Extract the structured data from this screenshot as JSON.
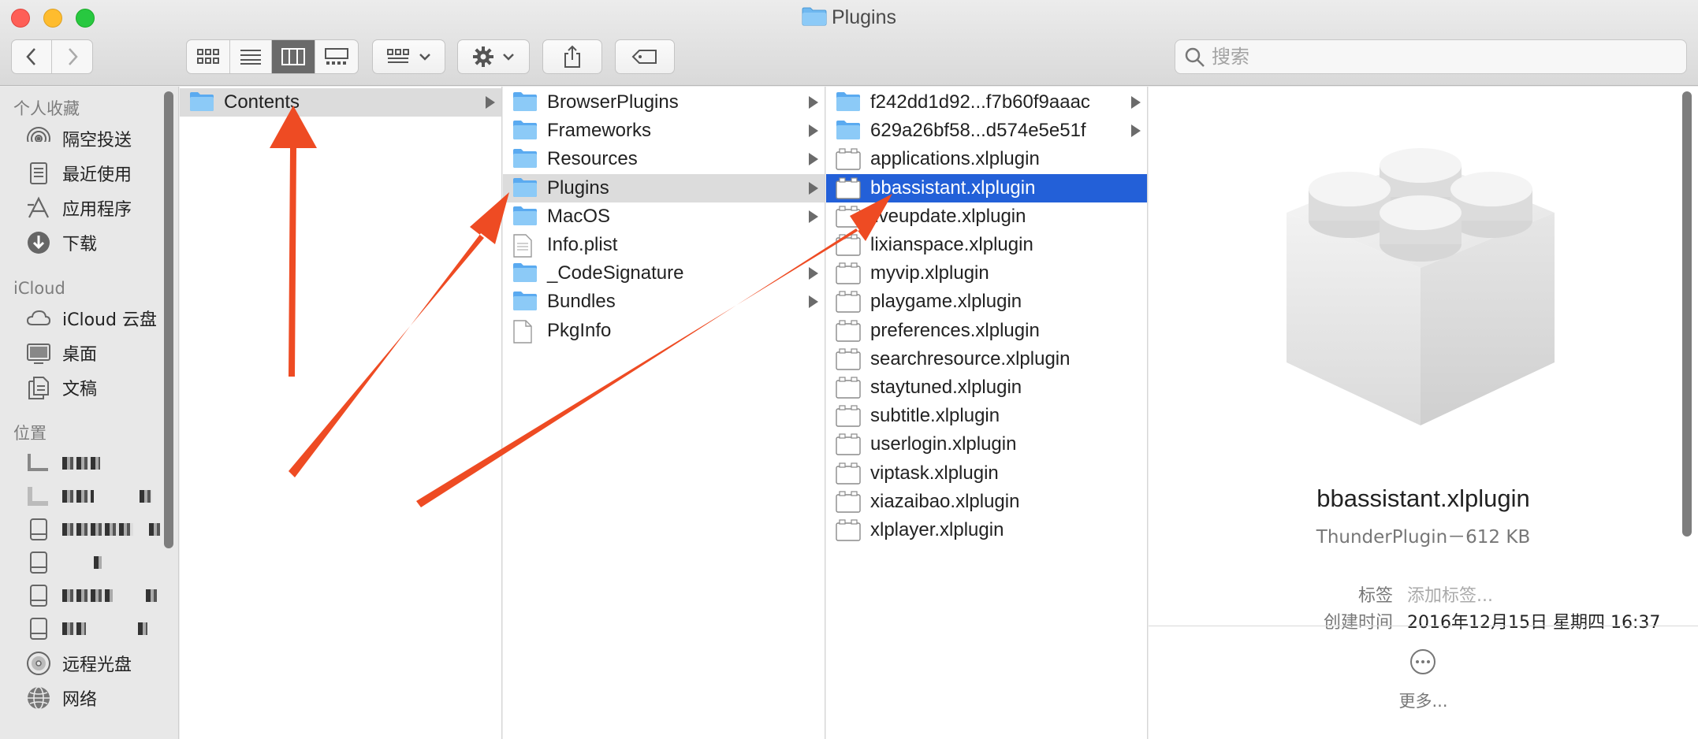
{
  "window": {
    "title": "Plugins"
  },
  "toolbar": {
    "back_label": "",
    "forward_label": "",
    "view_modes": [
      "icon-view",
      "list-view",
      "column-view",
      "gallery-view"
    ],
    "active_view": "column-view"
  },
  "search": {
    "placeholder": "搜索"
  },
  "sidebar": {
    "sections": [
      {
        "title": "个人收藏",
        "items": [
          {
            "label": "隔空投送",
            "icon": "airdrop-icon"
          },
          {
            "label": "最近使用",
            "icon": "recents-icon"
          },
          {
            "label": "应用程序",
            "icon": "applications-icon"
          },
          {
            "label": "下载",
            "icon": "downloads-icon"
          }
        ]
      },
      {
        "title": "iCloud",
        "items": [
          {
            "label": "iCloud 云盘",
            "icon": "icloud-icon"
          },
          {
            "label": "桌面",
            "icon": "desktop-icon"
          },
          {
            "label": "文稿",
            "icon": "documents-icon"
          }
        ]
      },
      {
        "title": "位置",
        "items": [
          {
            "label": "",
            "icon": "computer-icon"
          },
          {
            "label": "",
            "icon": "disk-icon"
          },
          {
            "label": "",
            "icon": "disk-icon"
          },
          {
            "label": "",
            "icon": "disk-icon"
          },
          {
            "label": "",
            "icon": "disk-icon"
          },
          {
            "label": "",
            "icon": "disk-icon"
          },
          {
            "label": "远程光盘",
            "icon": "remote-disc-icon"
          },
          {
            "label": "网络",
            "icon": "network-icon"
          }
        ]
      }
    ]
  },
  "columns": {
    "col1": [
      {
        "name": "Contents",
        "type": "folder",
        "arrow": true,
        "state": "path"
      }
    ],
    "col2": [
      {
        "name": "BrowserPlugins",
        "type": "folder",
        "arrow": true
      },
      {
        "name": "Frameworks",
        "type": "folder",
        "arrow": true
      },
      {
        "name": "Resources",
        "type": "folder",
        "arrow": true
      },
      {
        "name": "Plugins",
        "type": "folder",
        "arrow": true,
        "state": "path"
      },
      {
        "name": "MacOS",
        "type": "folder",
        "arrow": true
      },
      {
        "name": "Info.plist",
        "type": "plist",
        "arrow": false
      },
      {
        "name": "_CodeSignature",
        "type": "folder",
        "arrow": true
      },
      {
        "name": "Bundles",
        "type": "folder",
        "arrow": true
      },
      {
        "name": "PkgInfo",
        "type": "file",
        "arrow": false
      }
    ],
    "col3": [
      {
        "name": "f242dd1d92...f7b60f9aaac",
        "type": "folder",
        "arrow": true
      },
      {
        "name": "629a26bf58...d574e5e51f",
        "type": "folder",
        "arrow": true
      },
      {
        "name": "applications.xlplugin",
        "type": "plugin",
        "arrow": false
      },
      {
        "name": "bbassistant.xlplugin",
        "type": "plugin",
        "arrow": false,
        "state": "selected"
      },
      {
        "name": "liveupdate.xlplugin",
        "type": "plugin",
        "arrow": false
      },
      {
        "name": "lixianspace.xlplugin",
        "type": "plugin",
        "arrow": false
      },
      {
        "name": "myvip.xlplugin",
        "type": "plugin",
        "arrow": false
      },
      {
        "name": "playgame.xlplugin",
        "type": "plugin",
        "arrow": false
      },
      {
        "name": "preferences.xlplugin",
        "type": "plugin",
        "arrow": false
      },
      {
        "name": "searchresource.xlplugin",
        "type": "plugin",
        "arrow": false
      },
      {
        "name": "staytuned.xlplugin",
        "type": "plugin",
        "arrow": false
      },
      {
        "name": "subtitle.xlplugin",
        "type": "plugin",
        "arrow": false
      },
      {
        "name": "userlogin.xlplugin",
        "type": "plugin",
        "arrow": false
      },
      {
        "name": "viptask.xlplugin",
        "type": "plugin",
        "arrow": false
      },
      {
        "name": "xiazaibao.xlplugin",
        "type": "plugin",
        "arrow": false
      },
      {
        "name": "xlplayer.xlplugin",
        "type": "plugin",
        "arrow": false
      }
    ]
  },
  "preview": {
    "icon": "plugin-lego-icon",
    "name": "bbassistant.xlplugin",
    "kind": "ThunderPlugin－612 KB",
    "tags_label": "标签",
    "tags_placeholder": "添加标签...",
    "created_label": "创建时间",
    "created_value": "2016年12月15日 星期四 16:37",
    "more_label": "更多..."
  },
  "colors": {
    "selection": "#2360d8",
    "path_highlight": "#dcdcdc",
    "annotation_arrow": "#ee4b23",
    "folder": "#6fb8f0"
  }
}
